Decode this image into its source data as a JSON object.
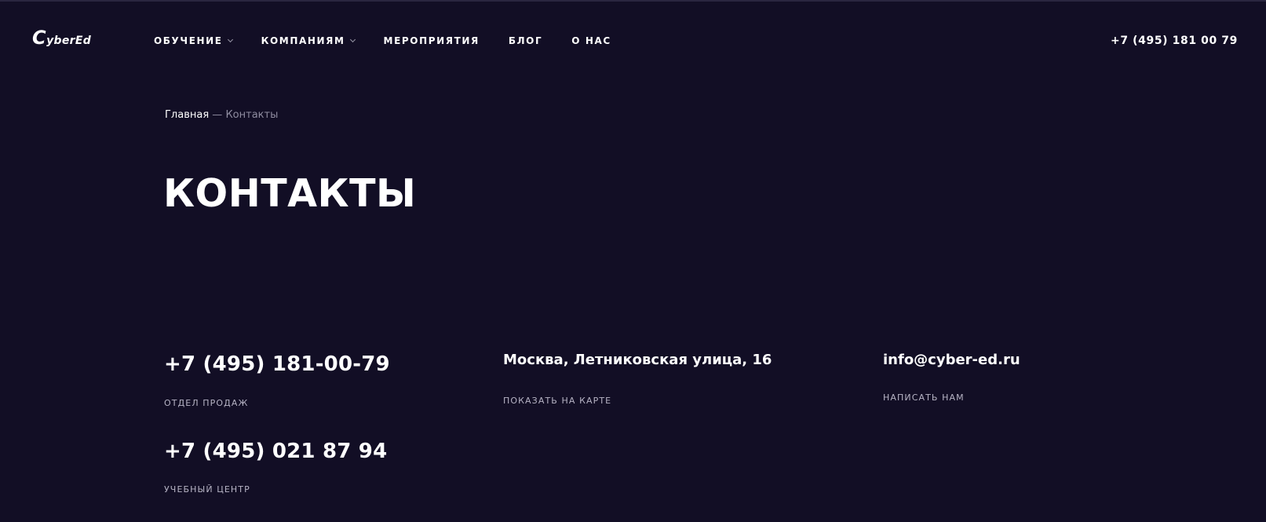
{
  "header": {
    "logo": {
      "first": "C",
      "rest": "yberEd"
    },
    "nav": [
      {
        "label": "ОБУЧЕНИЕ",
        "has_dropdown": true
      },
      {
        "label": "КОМПАНИЯМ",
        "has_dropdown": true
      },
      {
        "label": "МЕРОПРИЯТИЯ",
        "has_dropdown": false
      },
      {
        "label": "БЛОГ",
        "has_dropdown": false
      },
      {
        "label": "О НАС",
        "has_dropdown": false
      }
    ],
    "phone": "+7 (495) 181 00 79"
  },
  "breadcrumb": {
    "home": "Главная",
    "separator": "—",
    "current": "Контакты"
  },
  "main": {
    "title": "КОНТАКТЫ",
    "contacts": {
      "sales_phone": "+7 (495) 181-00-79",
      "sales_caption": "ОТДЕЛ ПРОДАЖ",
      "training_phone": "+7 (495) 021 87 94",
      "training_caption": "УЧЕБНЫЙ ЦЕНТР",
      "address": "Москва, Летниковская улица, 16",
      "map_link": "ПОКАЗАТЬ НА КАРТЕ",
      "email": "info@cyber-ed.ru",
      "write_link": "НАПИСАТЬ НАМ"
    }
  },
  "colors": {
    "background": "#120e25",
    "text": "#ffffff",
    "muted": "#8f8ca0",
    "caption": "#b6b3c4"
  },
  "icons": {
    "dropdown": "chevron-down-icon"
  }
}
